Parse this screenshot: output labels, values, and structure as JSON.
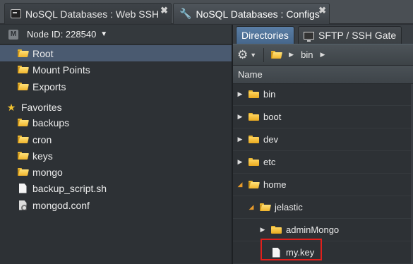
{
  "tabs": [
    {
      "label": "NoSQL Databases : Web SSH",
      "icon": "terminal-icon",
      "active": false,
      "close": "✖"
    },
    {
      "label": "NoSQL Databases : Configs",
      "icon": "wrench-icon",
      "active": true,
      "close": "✖"
    }
  ],
  "left": {
    "node_label": "Node ID: 228540",
    "node_icon_text": "M",
    "items": [
      {
        "label": "Root",
        "icon": "folder-open-icon",
        "selected": true
      },
      {
        "label": "Mount Points",
        "icon": "folder-open-icon"
      },
      {
        "label": "Exports",
        "icon": "folder-export-icon"
      }
    ],
    "favorites_label": "Favorites",
    "favorites": [
      {
        "label": "backups",
        "icon": "folder-open-icon"
      },
      {
        "label": "cron",
        "icon": "folder-open-icon"
      },
      {
        "label": "keys",
        "icon": "folder-open-icon"
      },
      {
        "label": "mongo",
        "icon": "folder-open-icon"
      },
      {
        "label": "backup_script.sh",
        "icon": "file-icon"
      },
      {
        "label": "mongod.conf",
        "icon": "config-file-icon"
      }
    ]
  },
  "right": {
    "tabs": [
      {
        "label": "Directories",
        "active": true
      },
      {
        "label": "SFTP / SSH Gate",
        "icon": "monitor-icon",
        "active": false
      }
    ],
    "breadcrumb": [
      "bin"
    ],
    "column_header": "Name",
    "rows": [
      {
        "label": "bin",
        "icon": "folder-icon",
        "expanded": false,
        "depth": 0
      },
      {
        "label": "boot",
        "icon": "folder-icon",
        "expanded": false,
        "depth": 0
      },
      {
        "label": "dev",
        "icon": "folder-icon",
        "expanded": false,
        "depth": 0
      },
      {
        "label": "etc",
        "icon": "folder-icon",
        "expanded": false,
        "depth": 0
      },
      {
        "label": "home",
        "icon": "folder-open-icon",
        "expanded": true,
        "depth": 0
      },
      {
        "label": "jelastic",
        "icon": "folder-open-icon",
        "expanded": true,
        "depth": 1
      },
      {
        "label": "adminMongo",
        "icon": "folder-icon",
        "expanded": false,
        "depth": 2
      },
      {
        "label": "my.key",
        "icon": "file-icon",
        "depth": 2,
        "highlighted": true
      }
    ]
  },
  "colors": {
    "accent": "#4a5a70",
    "tab_active": "#5a7ea6",
    "highlight": "#e0201c",
    "folder": "#f0b42c"
  }
}
